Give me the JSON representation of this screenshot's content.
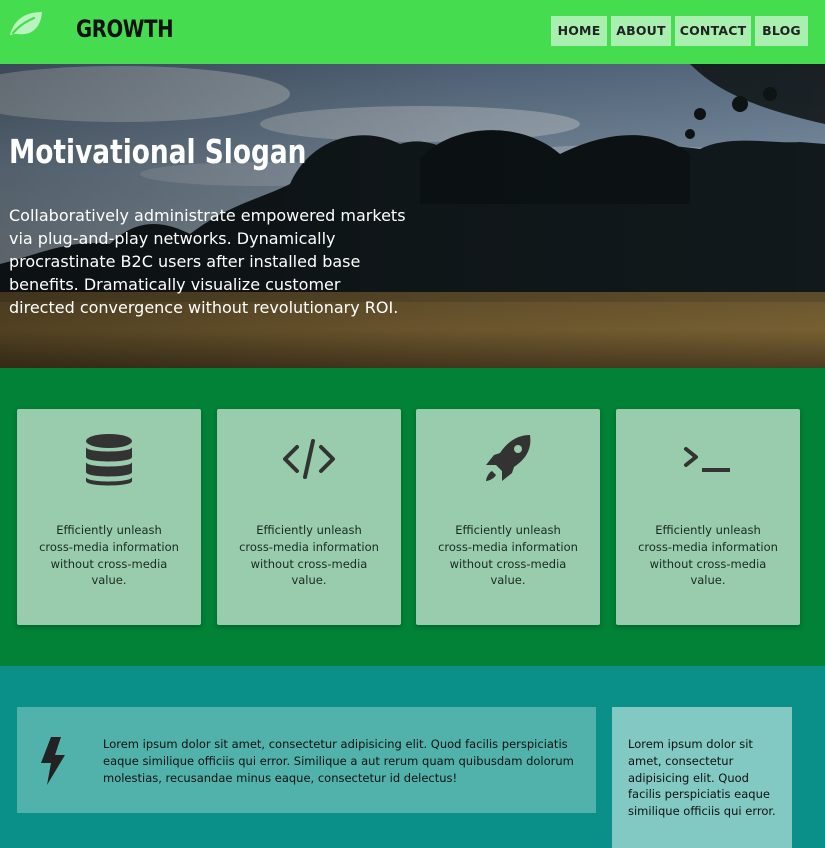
{
  "header": {
    "brand": "GROWTH",
    "logo_icon": "leaf-icon",
    "nav": [
      {
        "label": "HOME"
      },
      {
        "label": "ABOUT"
      },
      {
        "label": "CONTACT"
      },
      {
        "label": "BLOG"
      }
    ],
    "colors": {
      "bar": "#46dc50",
      "nav_button": "#a9f0b0"
    }
  },
  "hero": {
    "title": "Motivational Slogan",
    "text": "Collaboratively administrate empowered markets via plug-and-play networks. Dynamically procrastinate B2C users after installed base benefits. Dramatically visualize customer directed convergence without revolutionary ROI."
  },
  "features": {
    "background": "#018236",
    "card_color": "#99ccad",
    "cards": [
      {
        "icon": "database-icon",
        "text": "Efficiently unleash cross-media information without cross-media value."
      },
      {
        "icon": "code-icon",
        "text": "Efficiently unleash cross-media information without cross-media value."
      },
      {
        "icon": "rocket-icon",
        "text": "Efficiently unleash cross-media information without cross-media value."
      },
      {
        "icon": "terminal-icon",
        "text": "Efficiently unleash cross-media information without cross-media value."
      }
    ]
  },
  "bottom": {
    "background": "#0a9089",
    "info": {
      "icon": "lightning-bolt-icon",
      "text": "Lorem ipsum dolor sit amet, consectetur adipisicing elit. Quod facilis perspiciatis eaque similique officiis qui error. Similique a aut rerum quam quibusdam dolorum molestias, recusandae minus eaque, consectetur id delectus!"
    },
    "side": {
      "text": "Lorem ipsum dolor sit amet, consectetur adipisicing elit. Quod facilis perspiciatis eaque similique officiis qui error."
    }
  }
}
